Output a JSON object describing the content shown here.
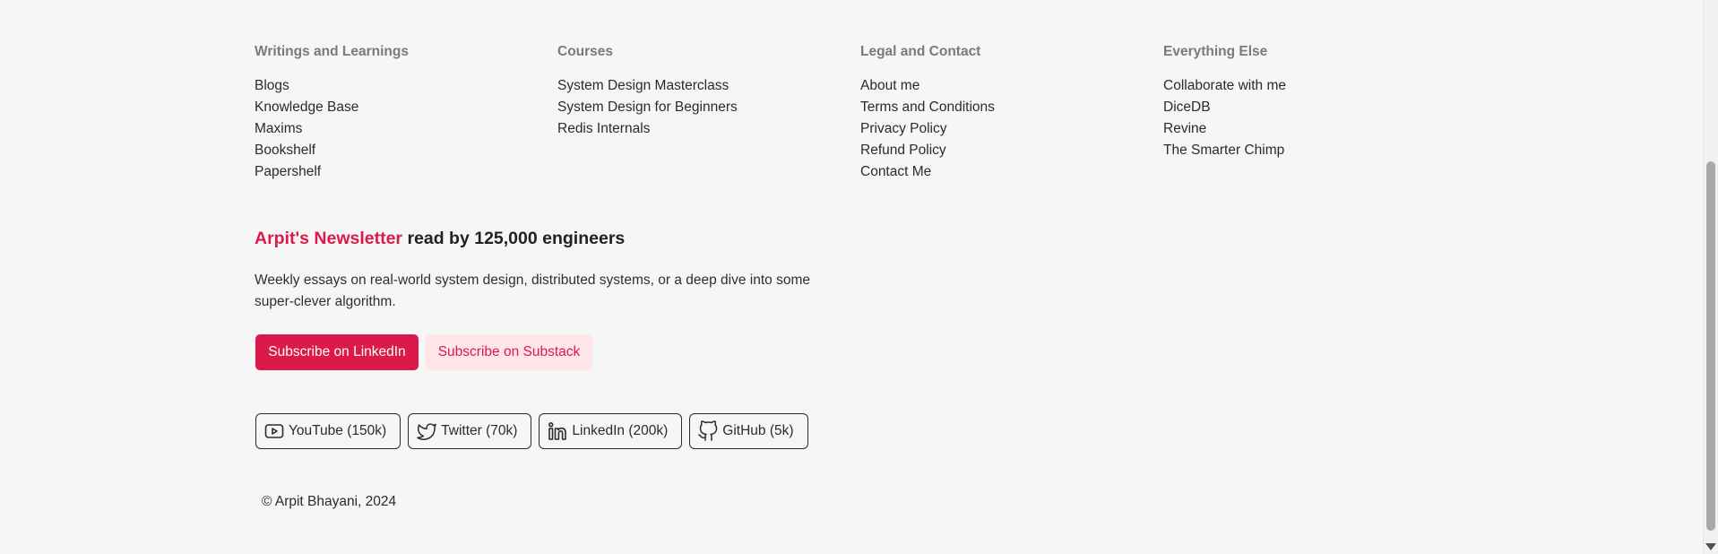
{
  "footer": {
    "columns": [
      {
        "title": "Writings and Learnings",
        "links": [
          "Blogs",
          "Knowledge Base",
          "Maxims",
          "Bookshelf",
          "Papershelf"
        ]
      },
      {
        "title": "Courses",
        "links": [
          "System Design Masterclass",
          "System Design for Beginners",
          "Redis Internals"
        ]
      },
      {
        "title": "Legal and Contact",
        "links": [
          "About me",
          "Terms and Conditions",
          "Privacy Policy",
          "Refund Policy",
          "Contact Me"
        ]
      },
      {
        "title": "Everything Else",
        "links": [
          "Collaborate with me",
          "DiceDB",
          "Revine",
          "The Smarter Chimp"
        ]
      }
    ]
  },
  "newsletter": {
    "brand": "Arpit's Newsletter",
    "heading_rest": " read by 125,000 engineers",
    "description": "Weekly essays on real-world system design, distributed systems, or a deep dive into some super-clever algorithm.",
    "subscribe_linkedin": "Subscribe on LinkedIn",
    "subscribe_substack": "Subscribe on Substack"
  },
  "socials": [
    {
      "label": "YouTube (150k)",
      "icon": "youtube-icon"
    },
    {
      "label": "Twitter (70k)",
      "icon": "twitter-icon"
    },
    {
      "label": "LinkedIn (200k)",
      "icon": "linkedin-icon"
    },
    {
      "label": "GitHub (5k)",
      "icon": "github-icon"
    }
  ],
  "copyright": "© Arpit Bhayani, 2024",
  "colors": {
    "accent": "#dc1a4a",
    "accent_light": "#fde5ea",
    "background": "#f6f6f6",
    "column_title": "#7a7a7a"
  }
}
